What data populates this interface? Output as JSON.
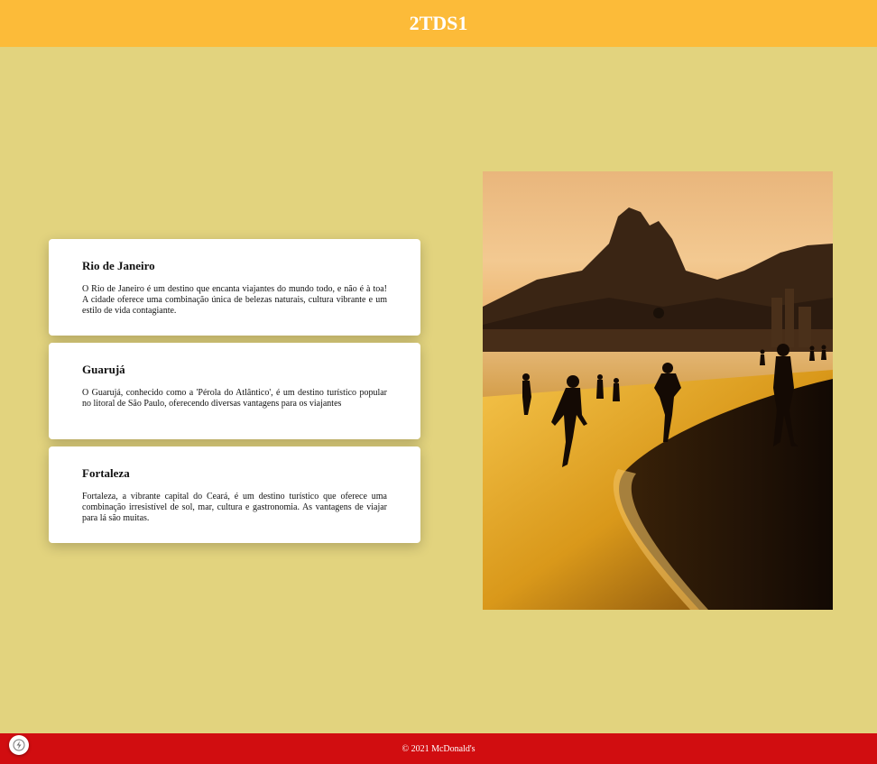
{
  "header": {
    "title": "2TDS1"
  },
  "cards": [
    {
      "title": "Rio de Janeiro",
      "text": "O Rio de Janeiro é um destino que encanta viajantes do mundo todo, e não é à toa! A cidade oferece uma combinação única de belezas naturais, cultura vibrante e um estilo de vida contagiante."
    },
    {
      "title": "Guarujá",
      "text": "O Guarujá, conhecido como a 'Pérola do Atlântico', é um destino turístico popular no litoral de São Paulo, oferecendo diversas vantagens para os viajantes"
    },
    {
      "title": "Fortaleza",
      "text": "Fortaleza, a vibrante capital do Ceará, é um destino turístico que oferece uma combinação irresistível de sol, mar, cultura e gastronomia. As vantagens de viajar para lá são muitas."
    }
  ],
  "image": {
    "subject": "beach-sunset-photo"
  },
  "footer": {
    "text": "© 2021 McDonald's"
  },
  "colors": {
    "header_bg": "#fcbb39",
    "page_bg": "#e2d37e",
    "footer_bg": "#d10d10",
    "card_bg": "#ffffff"
  }
}
